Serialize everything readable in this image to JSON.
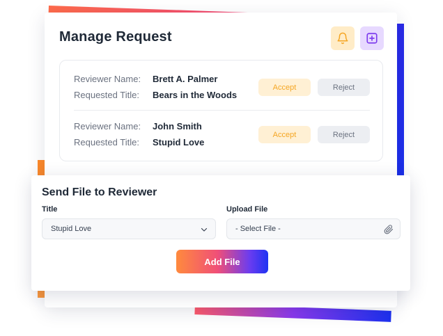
{
  "header": {
    "title": "Manage Request",
    "bell_icon": "bell-icon",
    "add_icon": "plus-square-icon"
  },
  "requests": [
    {
      "reviewer_label": "Reviewer Name:",
      "reviewer_name": "Brett A. Palmer",
      "title_label": "Requested Title:",
      "title_value": "Bears in the Woods",
      "accept_label": "Accept",
      "reject_label": "Reject"
    },
    {
      "reviewer_label": "Reviewer Name:",
      "reviewer_name": "John Smith",
      "title_label": "Requested Title:",
      "title_value": "Stupid Love",
      "accept_label": "Accept",
      "reject_label": "Reject"
    }
  ],
  "send_file": {
    "title": "Send File to Reviewer",
    "title_label": "Title",
    "title_selected": "Stupid Love",
    "upload_label": "Upload File",
    "upload_placeholder": "- Select File -",
    "submit_label": "Add File"
  },
  "colors": {
    "accept_bg": "#fff0d4",
    "accept_text": "#f5a623",
    "reject_bg": "#eceef2",
    "bell_bg": "#ffecc7",
    "add_bg": "#e7d9ff",
    "gradient_start": "#ff8a3d",
    "gradient_end": "#1f33f2"
  }
}
